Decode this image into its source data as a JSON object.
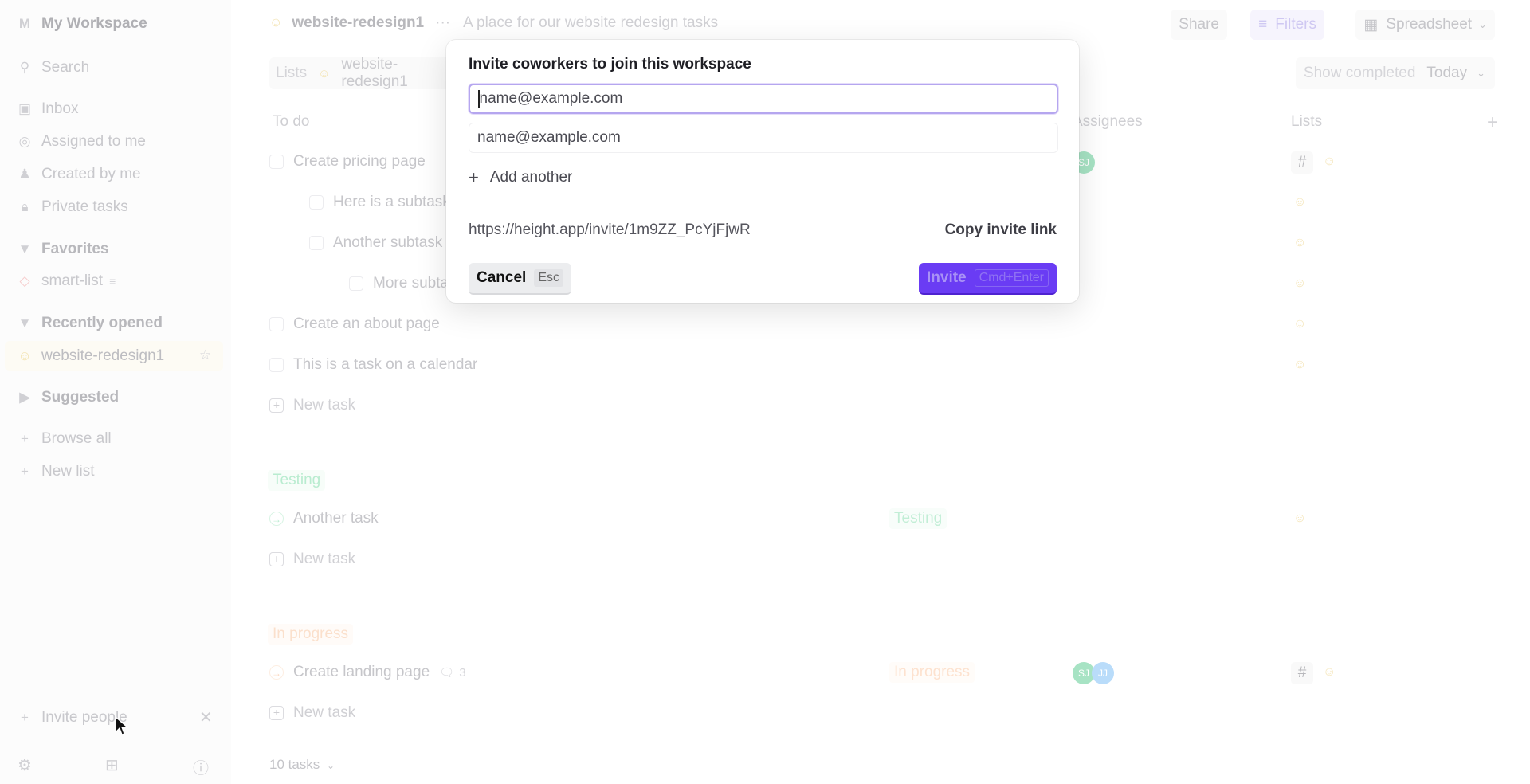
{
  "sidebar": {
    "workspace_badge": "M",
    "workspace_name": "My Workspace",
    "search_label": "Search",
    "nav": [
      {
        "label": "Inbox",
        "icon": "inbox-icon"
      },
      {
        "label": "Assigned to me",
        "icon": "target-icon"
      },
      {
        "label": "Created by me",
        "icon": "user-icon"
      },
      {
        "label": "Private tasks",
        "icon": "lock-icon"
      }
    ],
    "favorites_label": "Favorites",
    "favorites": [
      {
        "label": "smart-list"
      }
    ],
    "recent_label": "Recently opened",
    "recent": [
      {
        "label": "website-redesign1"
      }
    ],
    "suggested_label": "Suggested",
    "browse_all": "Browse all",
    "new_list": "New list",
    "invite_people": "Invite people"
  },
  "header": {
    "list_name": "website-redesign1",
    "more": "···",
    "description": "A place for our website redesign tasks",
    "share": "Share",
    "filters": "Filters",
    "view": "Spreadsheet"
  },
  "breadcrumbs": {
    "root": "Lists",
    "current": "website-redesign1"
  },
  "show_completed": {
    "label": "Show completed",
    "value": "Today"
  },
  "columns": {
    "assignees": "Assignees",
    "lists": "Lists"
  },
  "groups": [
    {
      "name": "To do",
      "tasks": [
        {
          "title": "Create pricing page",
          "indent": 0,
          "assignees": [
            "SJ"
          ],
          "lists": [
            "#",
            "website-redesign1"
          ]
        },
        {
          "title": "Here is a subtask",
          "indent": 1,
          "lists": [
            "website-redesign1"
          ]
        },
        {
          "title": "Another subtask",
          "indent": 1,
          "lists": [
            "website-redesign1"
          ]
        },
        {
          "title": "More subtasks",
          "indent": 2,
          "lists": [
            "website-redesign1"
          ]
        },
        {
          "title": "Create an about page",
          "indent": 0,
          "lists": [
            "website-redesign1"
          ]
        },
        {
          "title": "This is a task on a calendar",
          "indent": 0,
          "lists": [
            "website-redesign1"
          ]
        }
      ],
      "new_task": "New task"
    },
    {
      "name": "Testing",
      "color": "#4ade80",
      "tasks": [
        {
          "title": "Another task",
          "status": "Testing",
          "lists": [
            "website-redesign1"
          ]
        }
      ],
      "new_task": "New task"
    },
    {
      "name": "In progress",
      "color": "#fb923c",
      "tasks": [
        {
          "title": "Create landing page",
          "comments": "3",
          "status": "In progress",
          "assignees": [
            "SJ",
            "JJ"
          ],
          "lists": [
            "#",
            "website-redesign1"
          ]
        }
      ],
      "new_task": "New task"
    }
  ],
  "task_count": "10 tasks",
  "modal": {
    "title": "Invite coworkers to join this workspace",
    "email_placeholder_1": "name@example.com",
    "email_placeholder_2": "name@example.com",
    "add_another": "Add another",
    "invite_link": "https://height.app/invite/1m9ZZ_PcYjFjwR",
    "copy_link": "Copy invite link",
    "cancel": "Cancel",
    "cancel_kbd": "Esc",
    "invite": "Invite",
    "invite_kbd": "Cmd+Enter",
    "accent": "#6a3cf4"
  }
}
